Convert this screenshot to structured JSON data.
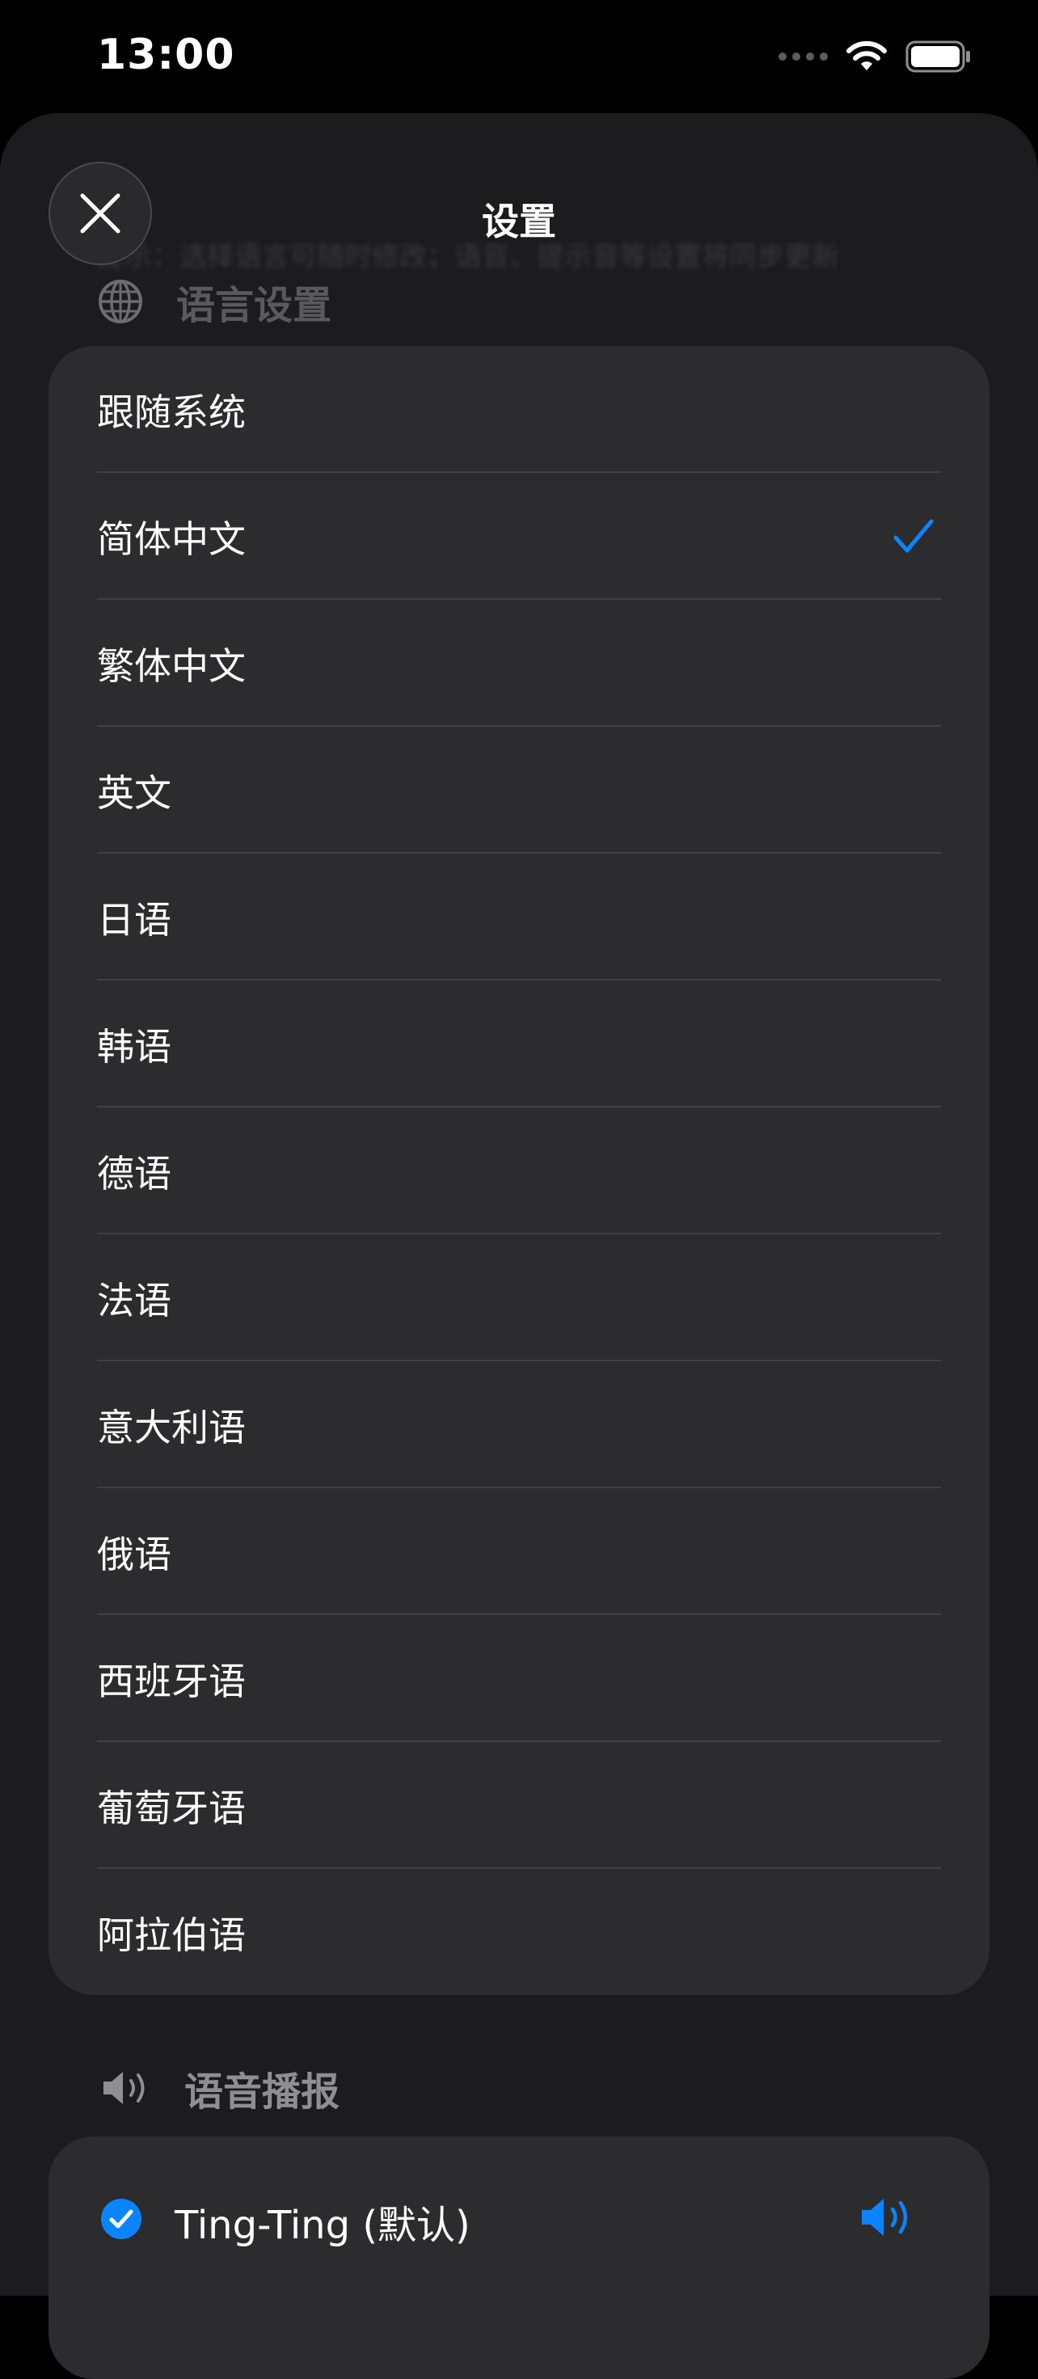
{
  "status_bar": {
    "time": "13:00"
  },
  "sheet": {
    "ghost_banner": "提示：选择语言可随时修改；语音、提示音等设置将同步更新",
    "title": "设置"
  },
  "language_section": {
    "header": "语言设置",
    "icon": "globe-icon",
    "selected": "简体中文",
    "items": [
      {
        "label": "跟随系统",
        "selected": false
      },
      {
        "label": "简体中文",
        "selected": true
      },
      {
        "label": "繁体中文",
        "selected": false
      },
      {
        "label": "英文",
        "selected": false
      },
      {
        "label": "日语",
        "selected": false
      },
      {
        "label": "韩语",
        "selected": false
      },
      {
        "label": "德语",
        "selected": false
      },
      {
        "label": "法语",
        "selected": false
      },
      {
        "label": "意大利语",
        "selected": false
      },
      {
        "label": "俄语",
        "selected": false
      },
      {
        "label": "西班牙语",
        "selected": false
      },
      {
        "label": "葡萄牙语",
        "selected": false
      },
      {
        "label": "阿拉伯语",
        "selected": false
      }
    ]
  },
  "voice_section": {
    "header": "语音播报",
    "icon": "speaker-icon",
    "items": [
      {
        "label": "Ting-Ting (默认)",
        "selected": true
      }
    ]
  },
  "colors": {
    "accent": "#0a84ff",
    "background": "#000000",
    "sheet": "#1c1c1e",
    "card": "#2c2c2e",
    "separator": "#404043",
    "secondary_text": "#8e8e93"
  }
}
